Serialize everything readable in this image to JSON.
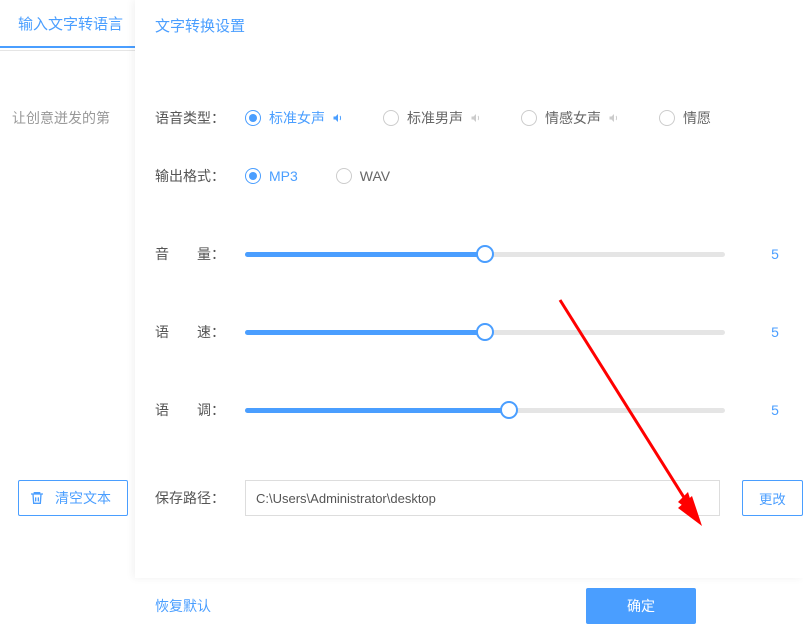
{
  "background": {
    "tab_label": "输入文字转语言",
    "hint_text": "让创意迸发的第",
    "clear_button": "清空文本"
  },
  "panel": {
    "title": "文字转换设置",
    "voice_type": {
      "label": "语音类型：",
      "options": [
        {
          "label": "标准女声",
          "selected": true,
          "speaker_active": true
        },
        {
          "label": "标准男声",
          "selected": false,
          "speaker_active": false
        },
        {
          "label": "情感女声",
          "selected": false,
          "speaker_active": false
        },
        {
          "label": "情愿",
          "selected": false,
          "speaker_active": false
        }
      ]
    },
    "output_format": {
      "label": "输出格式：",
      "options": [
        {
          "label": "MP3",
          "selected": true
        },
        {
          "label": "WAV",
          "selected": false
        }
      ]
    },
    "sliders": {
      "volume": {
        "label": "音　　量：",
        "value": 5,
        "fill_pct": 50
      },
      "speed": {
        "label": "语　　速：",
        "value": 5,
        "fill_pct": 50
      },
      "tone": {
        "label": "语　　调：",
        "value": 5,
        "fill_pct": 55
      }
    },
    "save_path": {
      "label": "保存路径：",
      "value": "C:\\Users\\Administrator\\desktop",
      "change_button": "更改"
    },
    "restore_default": "恢复默认",
    "confirm": "确定"
  }
}
